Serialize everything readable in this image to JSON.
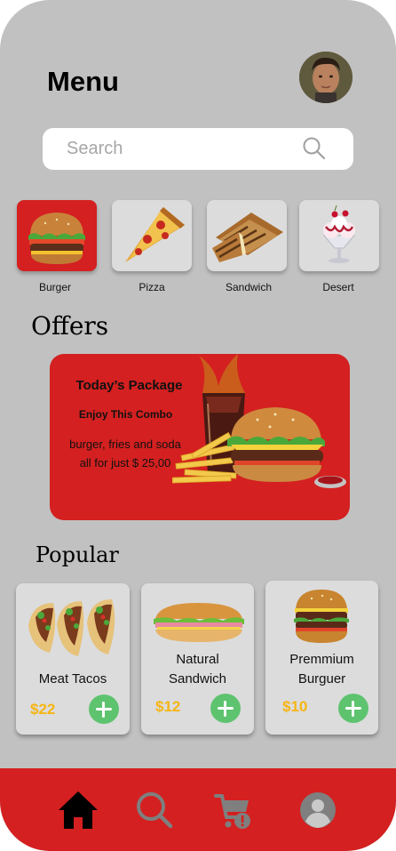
{
  "header": {
    "title": "Menu"
  },
  "search": {
    "placeholder": "Search"
  },
  "categories": [
    {
      "label": "Burger",
      "selected": true
    },
    {
      "label": "Pizza",
      "selected": false
    },
    {
      "label": "Sandwich",
      "selected": false
    },
    {
      "label": "Desert",
      "selected": false
    }
  ],
  "offers": {
    "section_title": "Offers",
    "title": "Today’s Package",
    "subtitle": "Enjoy This Combo",
    "description_line1": "burger, fries and soda",
    "description_line2": "all for just $ 25,00"
  },
  "popular": {
    "section_title": "Popular",
    "items": [
      {
        "name_line1": "Meat Tacos",
        "name_line2": "",
        "price": "$22"
      },
      {
        "name_line1": "Natural",
        "name_line2": "Sandwich",
        "price": "$12"
      },
      {
        "name_line1": "Premmium",
        "name_line2": "Burguer",
        "price": "$10"
      }
    ]
  },
  "nav": {
    "items": [
      "home-icon",
      "search-icon",
      "cart-icon",
      "profile-icon"
    ]
  },
  "colors": {
    "accent": "#d42020",
    "background": "#c1c1c1",
    "price": "#f5b514",
    "add_button": "#5ec36f"
  }
}
